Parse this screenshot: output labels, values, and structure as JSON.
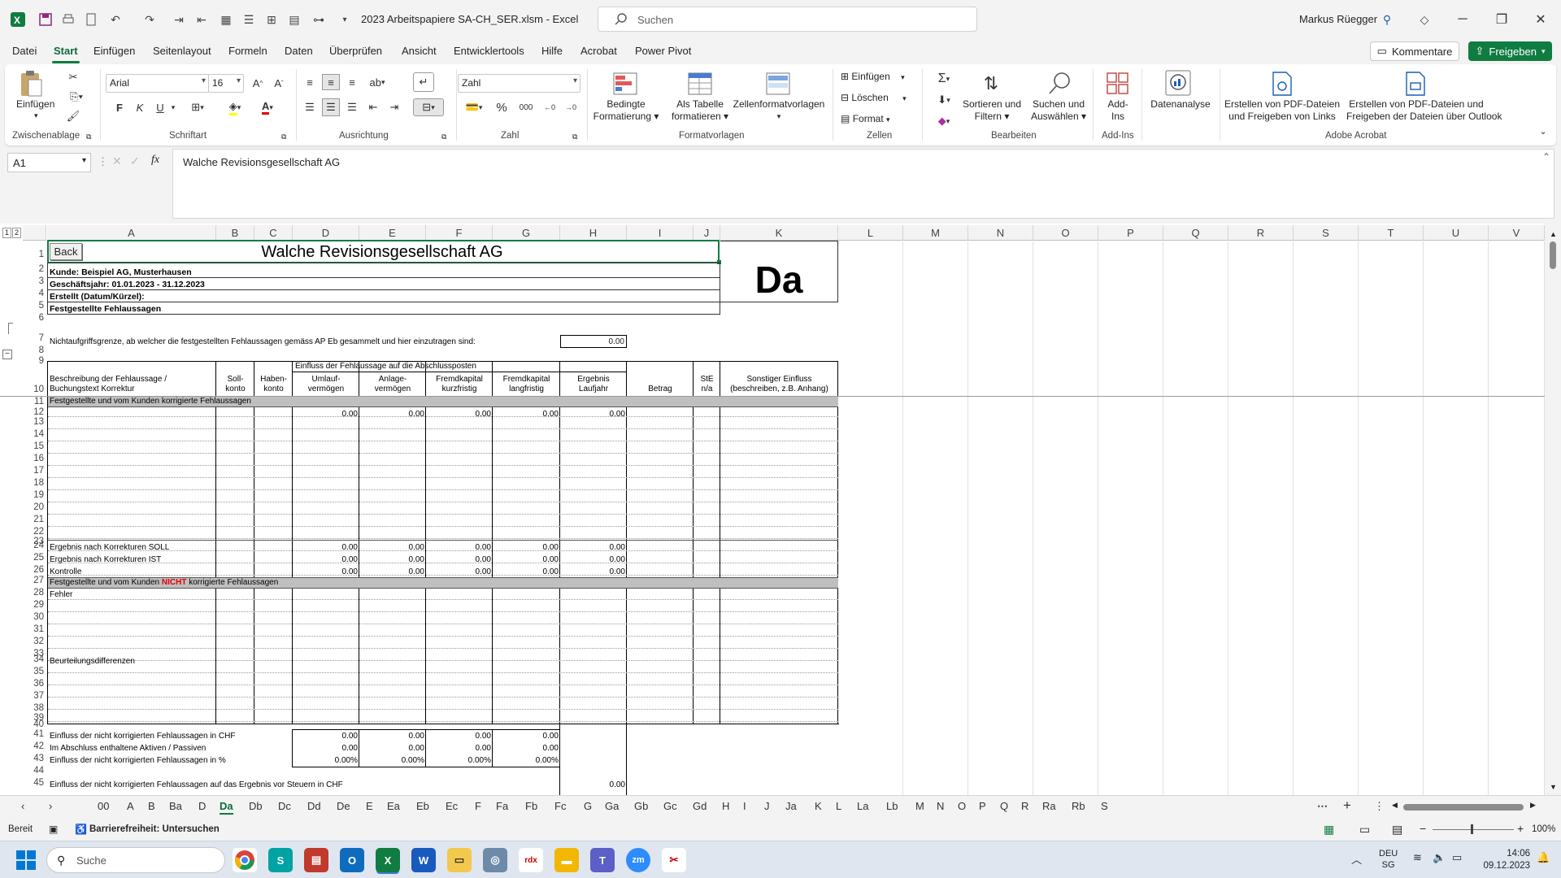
{
  "title_bar": {
    "filename": "2023 Arbeitspapiere SA-CH_SER.xlsm  -  Excel",
    "search_placeholder": "Suchen",
    "user_name": "Markus Rüegger"
  },
  "menu": {
    "items": [
      "Datei",
      "Start",
      "Einfügen",
      "Seitenlayout",
      "Formeln",
      "Daten",
      "Überprüfen",
      "Ansicht",
      "Entwicklertools",
      "Hilfe",
      "Acrobat",
      "Power Pivot"
    ],
    "active": "Start",
    "comments": "Kommentare",
    "share": "Freigeben"
  },
  "ribbon": {
    "paste": "Einfügen",
    "font_name": "Arial",
    "font_size": "16",
    "bold": "F",
    "italic": "K",
    "underline": "U",
    "number_format": "Zahl",
    "cond_format": [
      "Bedingte",
      "Formatierung"
    ],
    "as_table": [
      "Als Tabelle",
      "formatieren"
    ],
    "cell_styles": "Zellenformatvorlagen",
    "cells_insert": "Einfügen",
    "cells_delete": "Löschen",
    "cells_format": "Format",
    "sort_filter": [
      "Sortieren und",
      "Filtern"
    ],
    "find_select": [
      "Suchen und",
      "Auswählen"
    ],
    "addins": [
      "Add-",
      "Ins"
    ],
    "data_analysis": "Datenanalyse",
    "pdf_links": [
      "Erstellen von PDF-Dateien",
      "und Freigeben von Links"
    ],
    "pdf_outlook": [
      "Erstellen von PDF-Dateien und",
      "Freigeben der Dateien über Outlook"
    ],
    "groups": [
      "Zwischenablage",
      "Schriftart",
      "Ausrichtung",
      "Zahl",
      "Formatvorlagen",
      "Zellen",
      "Bearbeiten",
      "Add-Ins",
      "Adobe Acrobat"
    ]
  },
  "formula_bar": {
    "name_box": "A1",
    "fx": "fx",
    "content": "Walche Revisionsgesellschaft AG"
  },
  "grid": {
    "outline_levels": [
      "1",
      "2"
    ],
    "columns": [
      "A",
      "B",
      "C",
      "D",
      "E",
      "F",
      "G",
      "H",
      "I",
      "J",
      "K",
      "L",
      "M",
      "N",
      "O",
      "P",
      "Q",
      "R",
      "S",
      "T",
      "U",
      "V"
    ],
    "rows": [
      "1",
      "2",
      "3",
      "4",
      "5",
      "6",
      "7",
      "8",
      "9",
      "10",
      "11",
      "12",
      "13",
      "14",
      "15",
      "16",
      "17",
      "18",
      "19",
      "20",
      "21",
      "22",
      "23",
      "24",
      "25",
      "26",
      "27",
      "28",
      "29",
      "30",
      "31",
      "32",
      "33",
      "34",
      "35",
      "36",
      "37",
      "38",
      "39",
      "40",
      "41",
      "42",
      "43",
      "44",
      "45"
    ],
    "back_button": "Back",
    "company": "Walche Revisionsgesellschaft AG",
    "sheet_code": "Da",
    "client": "Kunde: Beispiel AG, Musterhausen",
    "fiscal_year": "Geschäftsjahr: 01.01.2023 - 31.12.2023",
    "created": "Erstellt (Datum/Kürzel):",
    "section_title": "Festgestellte Fehlaussagen",
    "threshold_text": "Nichtaufgriffsgrenze, ab welcher die festgestellten Fehlaussagen gemäss AP Eb gesammelt und hier einzutragen sind:",
    "threshold_value": "0.00",
    "influence_header": "Einfluss der Fehlaussage auf die Abschlussposten",
    "headers": {
      "desc": [
        "Beschreibung der Fehlaussage /",
        "Buchungstext Korrektur"
      ],
      "soll": [
        "Soll-",
        "konto"
      ],
      "haben": [
        "Haben-",
        "konto"
      ],
      "umlauf": [
        "Umlauf-",
        "vermögen"
      ],
      "anlage": [
        "Anlage-",
        "vermögen"
      ],
      "fk_kurz": [
        "Fremdkapital",
        "kurzfristig"
      ],
      "fk_lang": [
        "Fremdkapital",
        "langfristig"
      ],
      "ergebnis": [
        "Ergebnis",
        "Laufjahr"
      ],
      "betrag": "Betrag",
      "ste": [
        "StE",
        "n/a"
      ],
      "sonstiger": [
        "Sonstiger Einfluss",
        "(beschreiben, z.B. Anhang)"
      ]
    },
    "row11": "Festgestellte und vom Kunden korrigierte Fehlaussagen",
    "row12_values": [
      "0.00",
      "0.00",
      "0.00",
      "0.00",
      "0.00"
    ],
    "row24": {
      "label": "Ergebnis nach Korrekturen SOLL",
      "values": [
        "0.00",
        "0.00",
        "0.00",
        "0.00",
        "0.00"
      ]
    },
    "row25": {
      "label": "Ergebnis nach Korrekturen IST",
      "values": [
        "0.00",
        "0.00",
        "0.00",
        "0.00",
        "0.00"
      ]
    },
    "row26": {
      "label": "Kontrolle",
      "values": [
        "0.00",
        "0.00",
        "0.00",
        "0.00",
        "0.00"
      ]
    },
    "row27": {
      "pre": "Festgestellte und vom Kunden ",
      "red": "NICHT",
      "post": " korrigierte Fehlaussagen"
    },
    "row28": "Fehler",
    "row34": "Beurteilungsdifferenzen",
    "row41": {
      "label": "Einfluss der nicht korrigierten Fehlaussagen in CHF",
      "values": [
        "0.00",
        "0.00",
        "0.00",
        "0.00"
      ]
    },
    "row42": {
      "label": "Im Abschluss enthaltene Aktiven / Passiven",
      "values": [
        "0.00",
        "0.00",
        "0.00",
        "0.00"
      ]
    },
    "row43": {
      "label": "Einfluss der nicht korrigierten Fehlaussagen in %",
      "values": [
        "0.00%",
        "0.00%",
        "0.00%",
        "0.00%"
      ]
    },
    "row45": {
      "label": "Einfluss der nicht korrigierten Fehlaussagen auf das Ergebnis vor Steuern in CHF",
      "value": "0.00"
    }
  },
  "sheet_tabs": [
    "00",
    "A",
    "B",
    "Ba",
    "D",
    "Da",
    "Db",
    "Dc",
    "Dd",
    "De",
    "E",
    "Ea",
    "Eb",
    "Ec",
    "F",
    "Fa",
    "Fb",
    "Fc",
    "G",
    "Ga",
    "Gb",
    "Gc",
    "Gd",
    "H",
    "I",
    "J",
    "Ja",
    "K",
    "L",
    "La",
    "Lb",
    "M",
    "N",
    "O",
    "P",
    "Q",
    "R",
    "Ra",
    "Rb",
    "S"
  ],
  "active_tab": "Da",
  "status": {
    "ready": "Bereit",
    "accessibility": "Barrierefreiheit: Untersuchen",
    "zoom": "100%"
  },
  "taskbar": {
    "search": "Suche",
    "lang": "DEU",
    "region": "SG",
    "time": "14:06",
    "date": "09.12.2023"
  },
  "colors": {
    "accent": "#107c41",
    "excel_green": "#217346",
    "red_text": "#e00000",
    "gray_fill": "#bfbfbf"
  }
}
